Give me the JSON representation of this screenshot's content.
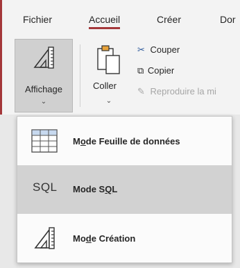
{
  "tabs": [
    {
      "label": "Fichier"
    },
    {
      "label": "Accueil"
    },
    {
      "label": "Créer"
    },
    {
      "label": "Dor"
    }
  ],
  "ribbon": {
    "affichage_label": "Affichage",
    "coller_label": "Coller",
    "couper_label": "Couper",
    "copier_label": "Copier",
    "reproduire_label": "Reproduire la mi"
  },
  "menu": {
    "items": [
      {
        "prefix": "M",
        "mnemonic": "o",
        "rest": "de Feuille de données",
        "selected": false
      },
      {
        "prefix": "Mode S",
        "mnemonic": "Q",
        "rest": "L",
        "glyph": "SQL",
        "selected": true
      },
      {
        "prefix": "Mo",
        "mnemonic": "d",
        "rest": "e Création",
        "selected": false
      }
    ]
  },
  "colors": {
    "accent": "#a4373a",
    "selected": "#d2d2d2",
    "pressed": "#d0d0d0"
  }
}
